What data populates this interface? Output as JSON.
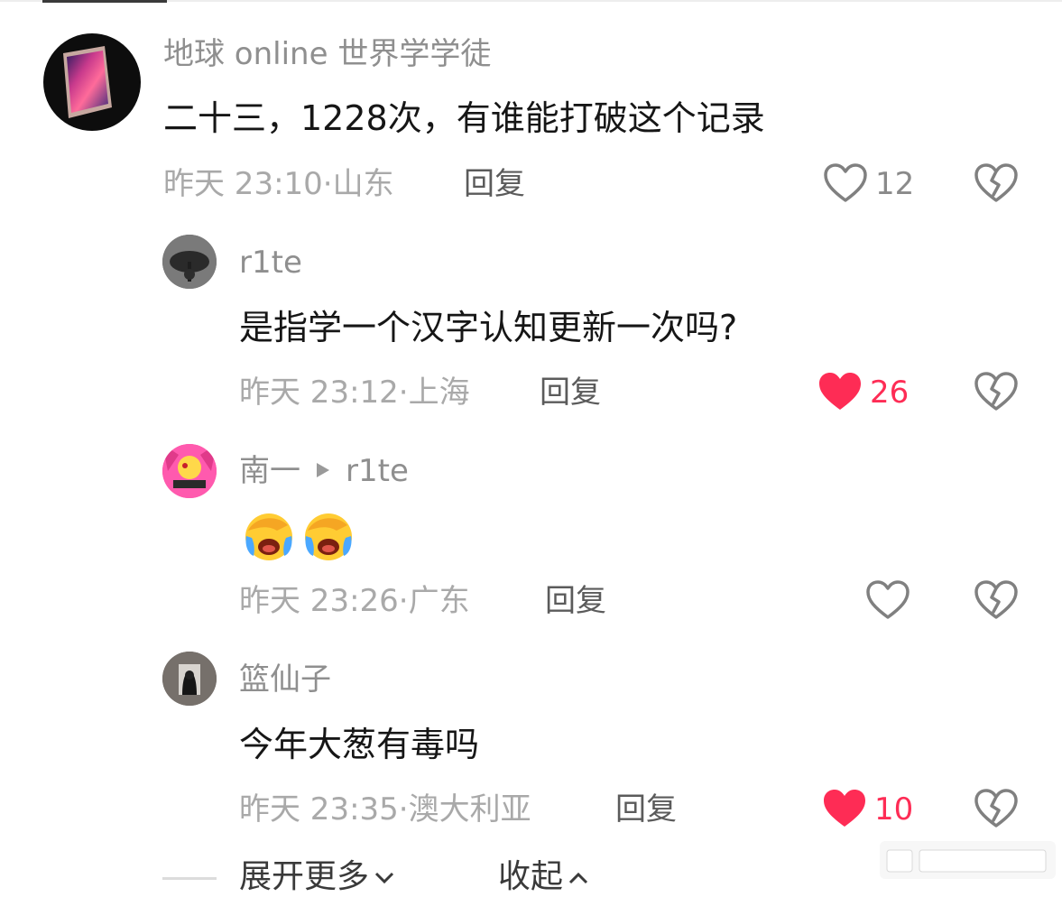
{
  "comments": [
    {
      "username": "地球 online 世界学学徒",
      "content": "二十三，1228次，有谁能打破这个记录",
      "time": "昨天 23:10",
      "location": "山东",
      "reply_label": "回复",
      "likes": "12",
      "liked": false
    },
    {
      "username": "r1te",
      "content": "是指学一个汉字认知更新一次吗?",
      "time": "昨天 23:12",
      "location": "上海",
      "reply_label": "回复",
      "likes": "26",
      "liked": true
    },
    {
      "username": "南一",
      "reply_to": "r1te",
      "emojis": [
        "face-palm-crying-emoji",
        "face-palm-crying-emoji"
      ],
      "time": "昨天 23:26",
      "location": "广东",
      "reply_label": "回复",
      "likes": "",
      "liked": false
    },
    {
      "username": "篮仙子",
      "content": "今年大葱有毒吗",
      "time": "昨天 23:35",
      "location": "澳大利亚",
      "reply_label": "回复",
      "likes": "10",
      "liked": true
    }
  ],
  "footer": {
    "expand_more": "展开更多",
    "collapse": "收起"
  },
  "colors": {
    "liked_red": "#fe2c55",
    "meta_gray": "#a9a9a9",
    "username_gray": "#8f8f8f",
    "text_dark": "#161616"
  }
}
